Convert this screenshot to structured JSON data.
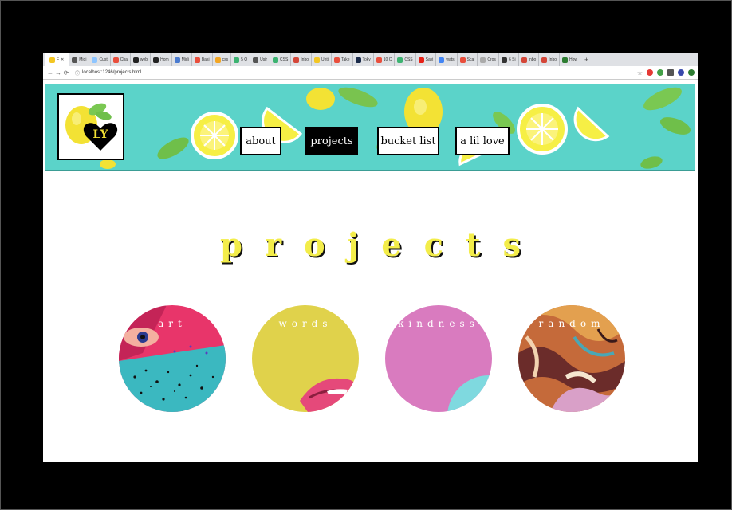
{
  "tabs": [
    {
      "label": "F",
      "color": "#f3c623",
      "active": true
    },
    {
      "label": "Midi",
      "color": "#555"
    },
    {
      "label": "Cust",
      "color": "#8ec5ff"
    },
    {
      "label": "Cha",
      "color": "#e94e3c"
    },
    {
      "label": "web",
      "color": "#222"
    },
    {
      "label": "Hom",
      "color": "#222"
    },
    {
      "label": "Midi",
      "color": "#4a7bd0"
    },
    {
      "label": "Basi",
      "color": "#e94e3c"
    },
    {
      "label": "css",
      "color": "#f3a623"
    },
    {
      "label": "5 Q",
      "color": "#3cb371"
    },
    {
      "label": "Usir",
      "color": "#555"
    },
    {
      "label": "CSS",
      "color": "#3cb371"
    },
    {
      "label": "Inbo",
      "color": "#d44638"
    },
    {
      "label": "Unti",
      "color": "#f3c623"
    },
    {
      "label": "Take",
      "color": "#e94e3c"
    },
    {
      "label": "Toky",
      "color": "#1a2a4a"
    },
    {
      "label": "10 C",
      "color": "#e94e3c"
    },
    {
      "label": "CSS",
      "color": "#3cb371"
    },
    {
      "label": "Savi",
      "color": "#e62117"
    },
    {
      "label": "wats",
      "color": "#4285f4"
    },
    {
      "label": "Scal",
      "color": "#e94e3c"
    },
    {
      "label": "Cros",
      "color": "#aaa"
    },
    {
      "label": "6 Si",
      "color": "#333"
    },
    {
      "label": "Inbo",
      "color": "#d44638"
    },
    {
      "label": "Inbo",
      "color": "#d44638"
    },
    {
      "label": "How",
      "color": "#2e7d32"
    }
  ],
  "address": {
    "url": "localhost:1246/projects.html"
  },
  "logo": {
    "text": "LY"
  },
  "nav": [
    {
      "label": "about",
      "active": false
    },
    {
      "label": "projects",
      "active": true
    },
    {
      "label": "bucket list",
      "active": false
    },
    {
      "label": "a lil love",
      "active": false
    }
  ],
  "title": "projects",
  "projects": [
    {
      "label": "art"
    },
    {
      "label": "words"
    },
    {
      "label": "kindness"
    },
    {
      "label": "random"
    }
  ],
  "colors": {
    "hero_bg": "#5bd3c9",
    "title_yellow": "#f3ed4a",
    "words_yellow": "#e0d24b",
    "kindness_pink": "#d97bbf",
    "art_pink": "#e8356a",
    "art_teal": "#3bb8c0"
  }
}
